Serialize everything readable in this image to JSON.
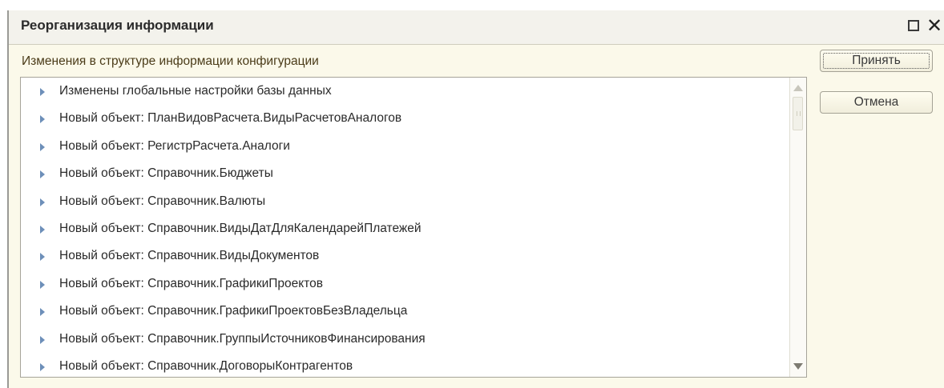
{
  "window": {
    "title": "Реорганизация информации",
    "maximize_icon": "maximize-icon",
    "close_icon": "close-icon",
    "close_glyph": "✕"
  },
  "section_label": "Изменения в структуре информации конфигурации",
  "changes": [
    "Изменены глобальные настройки базы данных",
    "Новый объект: ПланВидовРасчета.ВидыРасчетовАналогов",
    "Новый объект: РегистрРасчета.Аналоги",
    "Новый объект: Справочник.Бюджеты",
    "Новый объект: Справочник.Валюты",
    "Новый объект: Справочник.ВидыДатДляКалендарейПлатежей",
    "Новый объект: Справочник.ВидыДокументов",
    "Новый объект: Справочник.ГрафикиПроектов",
    "Новый объект: Справочник.ГрафикиПроектовБезВладельца",
    "Новый объект: Справочник.ГруппыИсточниковФинансирования",
    "Новый объект: Справочник.ДоговорыКонтрагентов"
  ],
  "buttons": {
    "accept_label": "Принять",
    "cancel_label": "Отмена"
  },
  "colors": {
    "window_bg": "#fbf9ea",
    "row_arrow": "#6d8fb9",
    "label_text": "#4a3b18"
  }
}
